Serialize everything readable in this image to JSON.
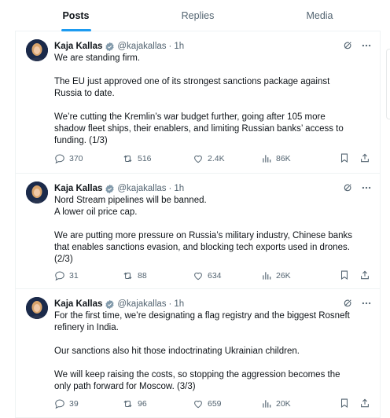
{
  "tabs": [
    {
      "label": "Posts",
      "active": true
    },
    {
      "label": "Replies",
      "active": false
    },
    {
      "label": "Media",
      "active": false
    }
  ],
  "tweets": [
    {
      "name": "Kaja Kallas",
      "handle": "@kajakallas",
      "dot": "·",
      "time": "1h",
      "paragraphs": [
        [
          "We are standing firm."
        ],
        [
          "The EU just approved one of its strongest sanctions package against",
          "Russia to date."
        ],
        [
          "We’re cutting the Kremlin’s war budget further, going after 105 more",
          "shadow fleet ships, their enablers, and limiting Russian banks’ access to",
          "funding. (1/3)"
        ]
      ],
      "replies": "370",
      "reposts": "516",
      "likes": "2.4K",
      "views": "86K"
    },
    {
      "name": "Kaja Kallas",
      "handle": "@kajakallas",
      "dot": "·",
      "time": "1h",
      "paragraphs": [
        [
          "Nord Stream pipelines will be banned.",
          "A lower oil price cap."
        ],
        [
          "We are putting more pressure on Russia’s military industry, Chinese banks",
          "that enables sanctions evasion, and blocking tech exports used in drones.",
          "(2/3)"
        ]
      ],
      "replies": "31",
      "reposts": "88",
      "likes": "634",
      "views": "26K"
    },
    {
      "name": "Kaja Kallas",
      "handle": "@kajakallas",
      "dot": "·",
      "time": "1h",
      "paragraphs": [
        [
          "For the first time, we’re designating a flag registry and the biggest Rosneft",
          "refinery in India."
        ],
        [
          "Our sanctions also hit those indoctrinating Ukrainian children."
        ],
        [
          "We will keep raising the costs, so stopping the aggression becomes the",
          "only path forward for Moscow. (3/3)"
        ]
      ],
      "replies": "39",
      "reposts": "96",
      "likes": "659",
      "views": "20K"
    }
  ],
  "colors": {
    "accent": "#1d9bf0",
    "verified_badge": "#829aab",
    "secondary_text": "#536471",
    "primary_text": "#0f1419"
  },
  "icons": [
    "verified-badge-icon",
    "grok-icon",
    "more-icon",
    "reply-icon",
    "repost-icon",
    "like-icon",
    "views-icon",
    "bookmark-icon",
    "share-icon"
  ]
}
